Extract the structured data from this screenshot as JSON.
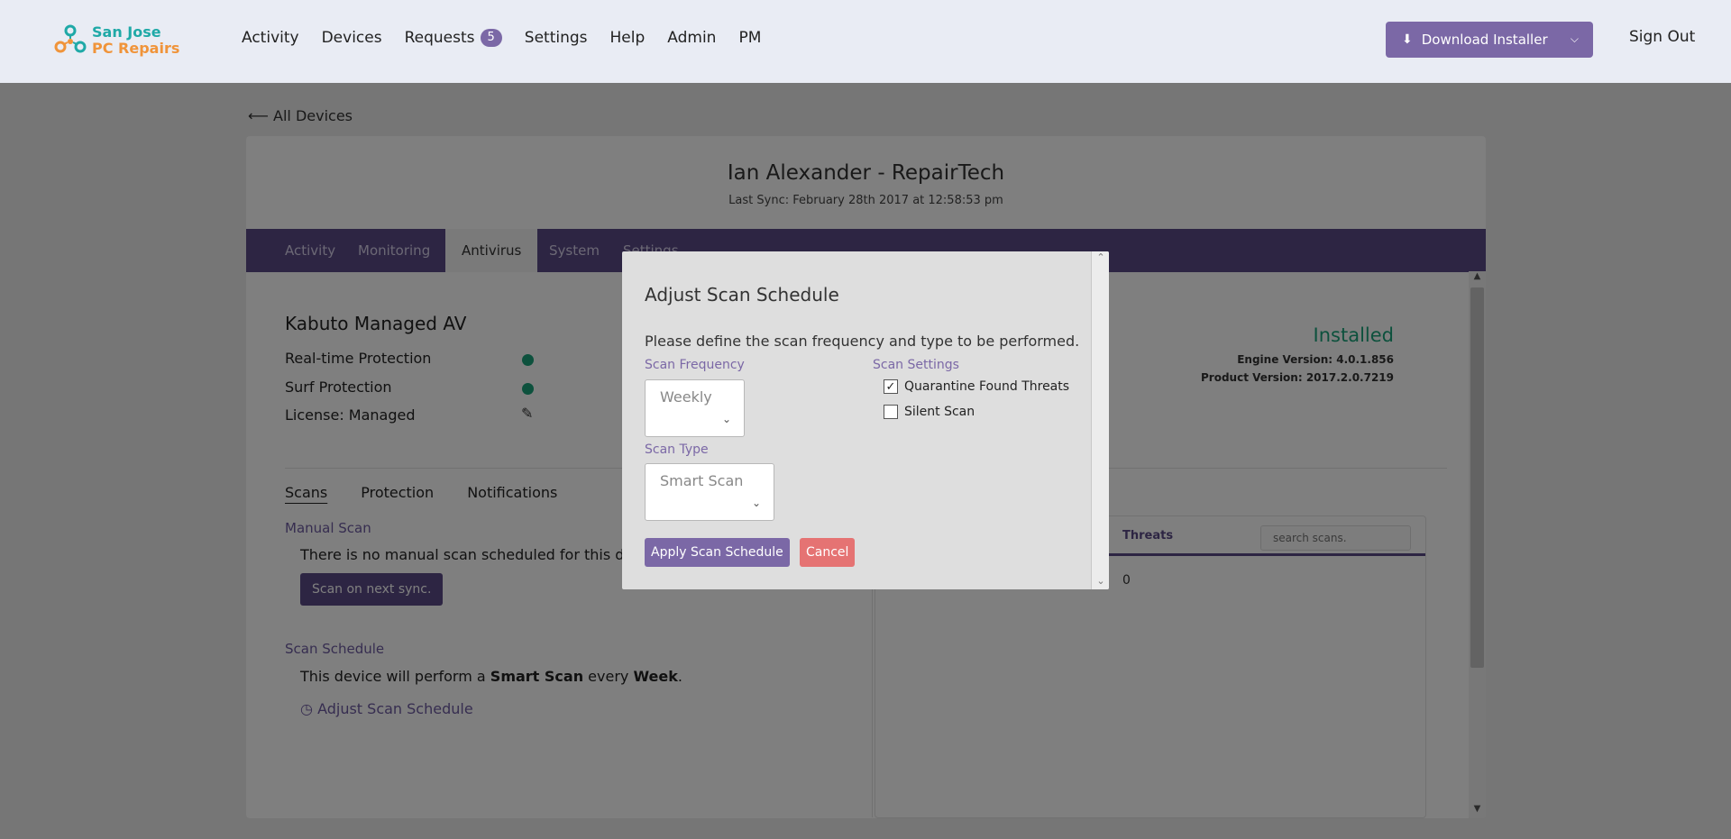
{
  "brand": {
    "line1": "San Jose",
    "line2": "PC Repairs",
    "teal": "#1fa9a7",
    "orange": "#f0943a"
  },
  "nav": {
    "items": [
      {
        "label": "Activity"
      },
      {
        "label": "Devices"
      },
      {
        "label": "Requests",
        "badge": "5"
      },
      {
        "label": "Settings"
      },
      {
        "label": "Help"
      },
      {
        "label": "Admin"
      },
      {
        "label": "PM"
      }
    ],
    "download_label": "Download Installer",
    "sign_out": "Sign Out"
  },
  "page": {
    "back_link": "All Devices",
    "device_title": "Ian Alexander - RepairTech",
    "last_sync": "Last Sync: February 28th 2017 at 12:58:53 pm",
    "tabs": [
      "Activity",
      "Monitoring",
      "Antivirus",
      "System",
      "Settings"
    ],
    "active_tab": "Antivirus",
    "av": {
      "title": "Kabuto Managed AV",
      "realtime": "Real-time Protection",
      "surf": "Surf Protection",
      "license": "License: Managed",
      "status": "Installed",
      "engine_version": "Engine Version: 4.0.1.856",
      "product_version": "Product Version: 2017.2.0.7219",
      "status_color": "#1aa37a"
    },
    "subtabs": [
      "Scans",
      "Protection",
      "Notifications"
    ],
    "manual_scan": {
      "heading": "Manual Scan",
      "text": "There is no manual scan scheduled for this device.",
      "button": "Scan on next sync."
    },
    "schedule": {
      "heading": "Scan Schedule",
      "text_prefix": "This device will perform a ",
      "scan_type": "Smart Scan",
      "text_mid": " every ",
      "frequency": "Week",
      "text_end": ".",
      "adjust_link": "Adjust Scan Schedule"
    },
    "scans_table": {
      "col_threats": "Threats",
      "search_placeholder": "search scans.",
      "threats_value": "0"
    }
  },
  "modal": {
    "title": "Adjust Scan Schedule",
    "description": "Please define the scan frequency and type to be performed.",
    "frequency_label": "Scan Frequency",
    "frequency_value": "Weekly",
    "type_label": "Scan Type",
    "type_value": "Smart Scan",
    "settings_label": "Scan Settings",
    "quarantine_label": "Quarantine Found Threats",
    "quarantine_checked": true,
    "silent_label": "Silent Scan",
    "silent_checked": false,
    "apply_label": "Apply Scan Schedule",
    "cancel_label": "Cancel"
  },
  "colors": {
    "accent": "#7b68a6",
    "tabbar": "#5a4a86",
    "cancel": "#e57373"
  }
}
